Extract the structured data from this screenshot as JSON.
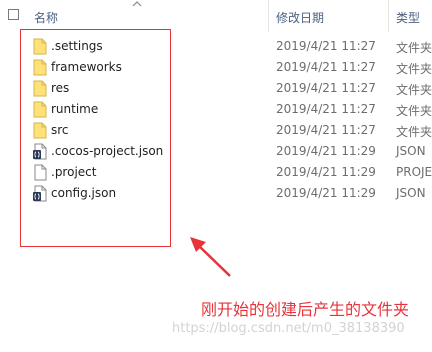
{
  "header": {
    "name_label": "名称",
    "date_label": "修改日期",
    "type_label": "类型"
  },
  "files": [
    {
      "name": ".settings",
      "date": "2019/4/21 11:27",
      "type": "文件夹",
      "icon": "folder-icon"
    },
    {
      "name": "frameworks",
      "date": "2019/4/21 11:27",
      "type": "文件夹",
      "icon": "folder-icon"
    },
    {
      "name": "res",
      "date": "2019/4/21 11:27",
      "type": "文件夹",
      "icon": "folder-icon"
    },
    {
      "name": "runtime",
      "date": "2019/4/21 11:27",
      "type": "文件夹",
      "icon": "folder-icon"
    },
    {
      "name": "src",
      "date": "2019/4/21 11:27",
      "type": "文件夹",
      "icon": "folder-icon"
    },
    {
      "name": ".cocos-project.json",
      "date": "2019/4/21 11:29",
      "type": "JSON",
      "icon": "json-file-icon"
    },
    {
      "name": ".project",
      "date": "2019/4/21 11:29",
      "type": "PROJE",
      "icon": "file-icon"
    },
    {
      "name": "config.json",
      "date": "2019/4/21 11:29",
      "type": "JSON",
      "icon": "json-file-icon"
    }
  ],
  "annotation": {
    "text": "刚开始的创建后产生的文件夹",
    "color": "#e8333a"
  },
  "watermark": "https://blog.csdn.net/m0_38138390"
}
